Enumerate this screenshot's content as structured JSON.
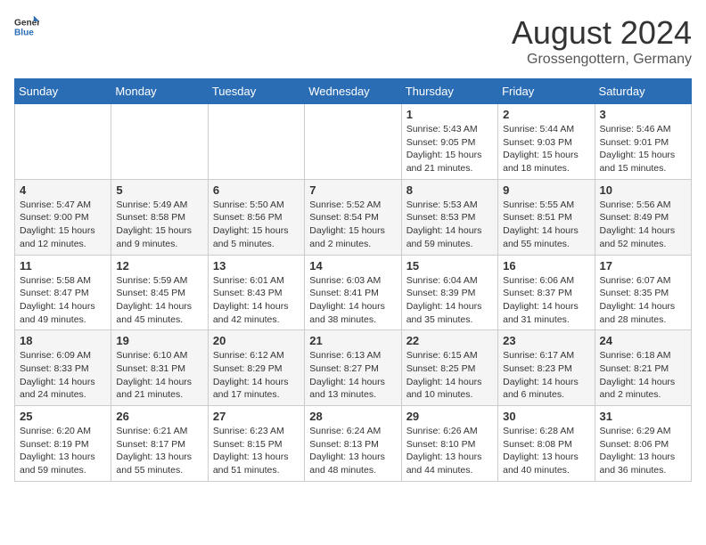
{
  "header": {
    "logo": {
      "general": "General",
      "blue": "Blue"
    },
    "title": "August 2024",
    "location": "Grossengottern, Germany"
  },
  "calendar": {
    "days_of_week": [
      "Sunday",
      "Monday",
      "Tuesday",
      "Wednesday",
      "Thursday",
      "Friday",
      "Saturday"
    ],
    "weeks": [
      [
        {
          "day": "",
          "info": ""
        },
        {
          "day": "",
          "info": ""
        },
        {
          "day": "",
          "info": ""
        },
        {
          "day": "",
          "info": ""
        },
        {
          "day": "1",
          "info": "Sunrise: 5:43 AM\nSunset: 9:05 PM\nDaylight: 15 hours and 21 minutes."
        },
        {
          "day": "2",
          "info": "Sunrise: 5:44 AM\nSunset: 9:03 PM\nDaylight: 15 hours and 18 minutes."
        },
        {
          "day": "3",
          "info": "Sunrise: 5:46 AM\nSunset: 9:01 PM\nDaylight: 15 hours and 15 minutes."
        }
      ],
      [
        {
          "day": "4",
          "info": "Sunrise: 5:47 AM\nSunset: 9:00 PM\nDaylight: 15 hours and 12 minutes."
        },
        {
          "day": "5",
          "info": "Sunrise: 5:49 AM\nSunset: 8:58 PM\nDaylight: 15 hours and 9 minutes."
        },
        {
          "day": "6",
          "info": "Sunrise: 5:50 AM\nSunset: 8:56 PM\nDaylight: 15 hours and 5 minutes."
        },
        {
          "day": "7",
          "info": "Sunrise: 5:52 AM\nSunset: 8:54 PM\nDaylight: 15 hours and 2 minutes."
        },
        {
          "day": "8",
          "info": "Sunrise: 5:53 AM\nSunset: 8:53 PM\nDaylight: 14 hours and 59 minutes."
        },
        {
          "day": "9",
          "info": "Sunrise: 5:55 AM\nSunset: 8:51 PM\nDaylight: 14 hours and 55 minutes."
        },
        {
          "day": "10",
          "info": "Sunrise: 5:56 AM\nSunset: 8:49 PM\nDaylight: 14 hours and 52 minutes."
        }
      ],
      [
        {
          "day": "11",
          "info": "Sunrise: 5:58 AM\nSunset: 8:47 PM\nDaylight: 14 hours and 49 minutes."
        },
        {
          "day": "12",
          "info": "Sunrise: 5:59 AM\nSunset: 8:45 PM\nDaylight: 14 hours and 45 minutes."
        },
        {
          "day": "13",
          "info": "Sunrise: 6:01 AM\nSunset: 8:43 PM\nDaylight: 14 hours and 42 minutes."
        },
        {
          "day": "14",
          "info": "Sunrise: 6:03 AM\nSunset: 8:41 PM\nDaylight: 14 hours and 38 minutes."
        },
        {
          "day": "15",
          "info": "Sunrise: 6:04 AM\nSunset: 8:39 PM\nDaylight: 14 hours and 35 minutes."
        },
        {
          "day": "16",
          "info": "Sunrise: 6:06 AM\nSunset: 8:37 PM\nDaylight: 14 hours and 31 minutes."
        },
        {
          "day": "17",
          "info": "Sunrise: 6:07 AM\nSunset: 8:35 PM\nDaylight: 14 hours and 28 minutes."
        }
      ],
      [
        {
          "day": "18",
          "info": "Sunrise: 6:09 AM\nSunset: 8:33 PM\nDaylight: 14 hours and 24 minutes."
        },
        {
          "day": "19",
          "info": "Sunrise: 6:10 AM\nSunset: 8:31 PM\nDaylight: 14 hours and 21 minutes."
        },
        {
          "day": "20",
          "info": "Sunrise: 6:12 AM\nSunset: 8:29 PM\nDaylight: 14 hours and 17 minutes."
        },
        {
          "day": "21",
          "info": "Sunrise: 6:13 AM\nSunset: 8:27 PM\nDaylight: 14 hours and 13 minutes."
        },
        {
          "day": "22",
          "info": "Sunrise: 6:15 AM\nSunset: 8:25 PM\nDaylight: 14 hours and 10 minutes."
        },
        {
          "day": "23",
          "info": "Sunrise: 6:17 AM\nSunset: 8:23 PM\nDaylight: 14 hours and 6 minutes."
        },
        {
          "day": "24",
          "info": "Sunrise: 6:18 AM\nSunset: 8:21 PM\nDaylight: 14 hours and 2 minutes."
        }
      ],
      [
        {
          "day": "25",
          "info": "Sunrise: 6:20 AM\nSunset: 8:19 PM\nDaylight: 13 hours and 59 minutes."
        },
        {
          "day": "26",
          "info": "Sunrise: 6:21 AM\nSunset: 8:17 PM\nDaylight: 13 hours and 55 minutes."
        },
        {
          "day": "27",
          "info": "Sunrise: 6:23 AM\nSunset: 8:15 PM\nDaylight: 13 hours and 51 minutes."
        },
        {
          "day": "28",
          "info": "Sunrise: 6:24 AM\nSunset: 8:13 PM\nDaylight: 13 hours and 48 minutes."
        },
        {
          "day": "29",
          "info": "Sunrise: 6:26 AM\nSunset: 8:10 PM\nDaylight: 13 hours and 44 minutes."
        },
        {
          "day": "30",
          "info": "Sunrise: 6:28 AM\nSunset: 8:08 PM\nDaylight: 13 hours and 40 minutes."
        },
        {
          "day": "31",
          "info": "Sunrise: 6:29 AM\nSunset: 8:06 PM\nDaylight: 13 hours and 36 minutes."
        }
      ]
    ]
  }
}
